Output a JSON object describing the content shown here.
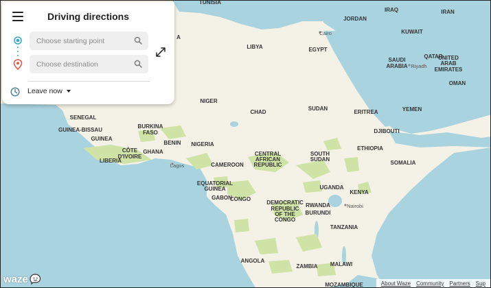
{
  "panel": {
    "title": "Driving directions",
    "start_placeholder": "Choose starting point",
    "dest_placeholder": "Choose destination",
    "leave_label": "Leave now"
  },
  "map": {
    "countries": [
      {
        "name": "TUNISIA"
      },
      {
        "name": "LIBYA"
      },
      {
        "name": "EGYPT"
      },
      {
        "name": "NIGER"
      },
      {
        "name": "CHAD"
      },
      {
        "name": "SUDAN"
      },
      {
        "name": "ERITREA"
      },
      {
        "name": "SENEGAL"
      },
      {
        "name": "GUINEA-BISSAU"
      },
      {
        "name": "GUINEA"
      },
      {
        "name": "BURKINA"
      },
      {
        "name": "FASO"
      },
      {
        "name": "BENIN"
      },
      {
        "name": "NIGERIA"
      },
      {
        "name": "CÔTE"
      },
      {
        "name": "D'IVOIRE"
      },
      {
        "name": "GHANA"
      },
      {
        "name": "LIBERIA"
      },
      {
        "name": "CAMEROON"
      },
      {
        "name": "CENTRAL"
      },
      {
        "name": "AFRICAN"
      },
      {
        "name": "REPUBLIC"
      },
      {
        "name": "SOUTH"
      },
      {
        "name": "SUDAN"
      },
      {
        "name": "ETHIOPIA"
      },
      {
        "name": "SOMALIA"
      },
      {
        "name": "DJIBOUTI"
      },
      {
        "name": "EQUATORIAL"
      },
      {
        "name": "GUINEA"
      },
      {
        "name": "GABON"
      },
      {
        "name": "CONGO"
      },
      {
        "name": "DEMOCRATIC"
      },
      {
        "name": "REPUBLIC"
      },
      {
        "name": "OF THE"
      },
      {
        "name": "CONGO"
      },
      {
        "name": "UGANDA"
      },
      {
        "name": "KENYA"
      },
      {
        "name": "RWANDA"
      },
      {
        "name": "BURUNDI"
      },
      {
        "name": "TANZANIA"
      },
      {
        "name": "ANGOLA"
      },
      {
        "name": "ZAMBIA"
      },
      {
        "name": "MALAWI"
      },
      {
        "name": "MOZAMBIQUE"
      },
      {
        "name": "JORDAN"
      },
      {
        "name": "IRAQ"
      },
      {
        "name": "IRAN"
      },
      {
        "name": "KUWAIT"
      },
      {
        "name": "SAUDI"
      },
      {
        "name": "ARABIA"
      },
      {
        "name": "QATAR"
      },
      {
        "name": "UNITED"
      },
      {
        "name": "ARAB"
      },
      {
        "name": "EMIRATES"
      },
      {
        "name": "OMAN"
      },
      {
        "name": "YEMEN"
      },
      {
        "name": "A"
      }
    ],
    "cities": [
      "Cairo",
      "Riyadh",
      "Lagos",
      "Nairobi"
    ]
  },
  "footer": {
    "about": "About Waze",
    "community": "Community",
    "partners": "Partners",
    "support": "Sup"
  },
  "logo": {
    "text": "waze"
  },
  "colors": {
    "land": "#f4f1e6",
    "water": "#a9d3df",
    "green": "#cfe3a6"
  }
}
